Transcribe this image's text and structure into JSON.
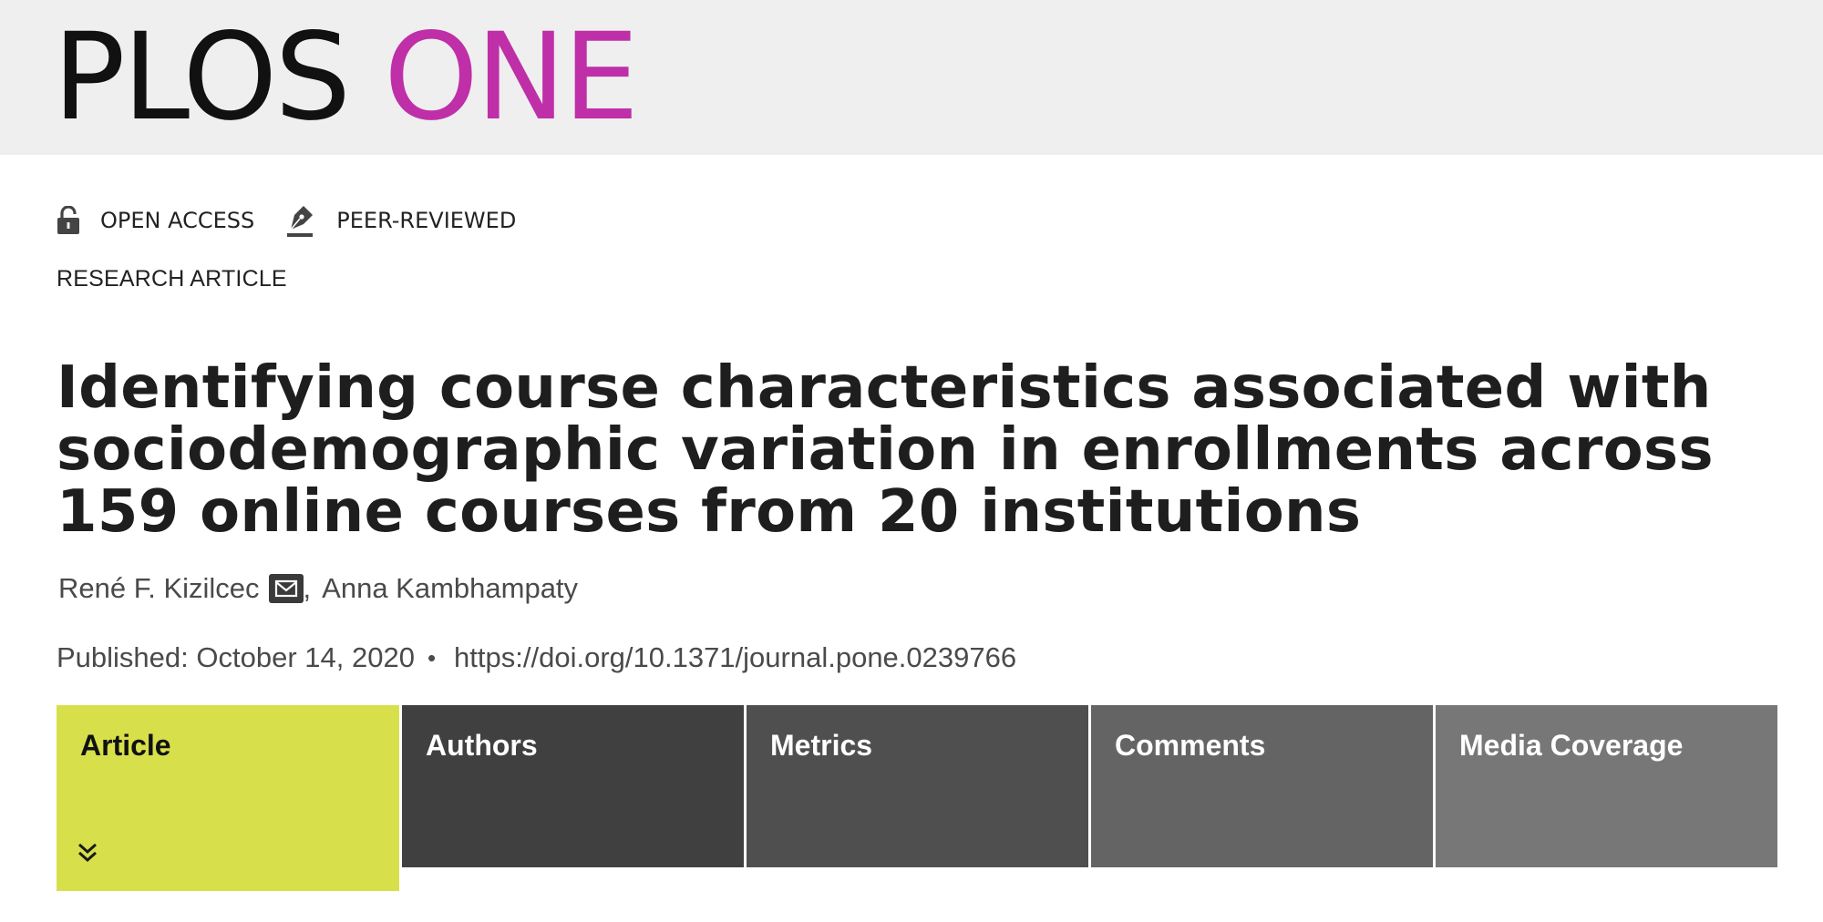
{
  "header": {
    "logo_part1": "PLOS",
    "logo_part2": "ONE",
    "logo_color_primary": "#111111",
    "logo_color_accent": "#bf2fa8",
    "background": "#efefef"
  },
  "badges": [
    {
      "label": "OPEN ACCESS",
      "icon": "open-lock-icon"
    },
    {
      "label": "PEER-REVIEWED",
      "icon": "pen-nib-icon"
    }
  ],
  "article": {
    "type": "RESEARCH ARTICLE",
    "title": "Identifying course characteristics associated with sociodemographic variation in enrollments across 159 online courses from 20 institutions",
    "authors": [
      {
        "name": "René F. Kizilcec",
        "corresponding": true
      },
      {
        "name": "Anna Kambhampaty",
        "corresponding": false
      }
    ],
    "author_separator": ",",
    "published_label": "Published: October 14, 2020",
    "bullet": "•",
    "doi": "https://doi.org/10.1371/journal.pone.0239766"
  },
  "tabs": [
    {
      "label": "Article",
      "active": true,
      "color": "#d7e04b"
    },
    {
      "label": "Authors",
      "active": false,
      "color": "#404040"
    },
    {
      "label": "Metrics",
      "active": false,
      "color": "#4f4f4f"
    },
    {
      "label": "Comments",
      "active": false,
      "color": "#646464"
    },
    {
      "label": "Media Coverage",
      "active": false,
      "color": "#777777"
    }
  ],
  "icons": {
    "mail": "envelope-icon",
    "expand": "double-chevron-down-icon"
  }
}
